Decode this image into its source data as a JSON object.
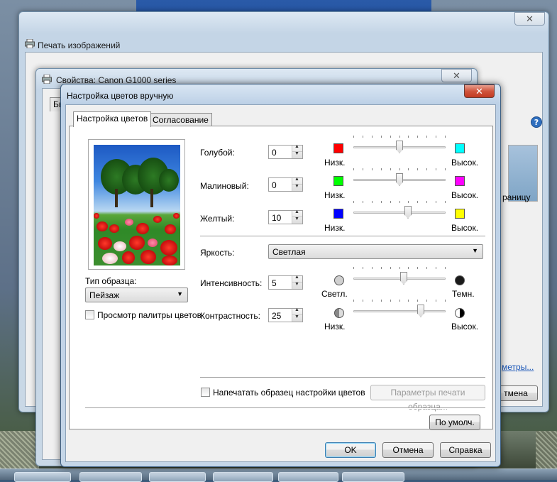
{
  "background_window": {
    "title": "Печать изображений",
    "partial_texts": {
      "rasteria": "раницу",
      "params_link": "метры...",
      "cancel_button": "тмена"
    }
  },
  "properties_window": {
    "title": "Свойства: Canon G1000 series",
    "partial_tab": "Бь",
    "close_glyph": "✕"
  },
  "dialog": {
    "title": "Настройка цветов вручную",
    "close_glyph": "✕",
    "tabs": [
      {
        "label": "Настройка цветов",
        "active": true
      },
      {
        "label": "Согласование",
        "active": false
      }
    ],
    "sample_type": {
      "label": "Тип образца:",
      "value": "Пейзаж"
    },
    "palette_preview": {
      "label": "Просмотр палитры цветов",
      "checked": false
    },
    "colors": [
      {
        "label": "Голубой:",
        "value": "0",
        "low_label": "Низк.",
        "high_label": "Высок.",
        "low_color": "#ff0000",
        "high_color": "#00ffff",
        "slider_level": 0.5
      },
      {
        "label": "Малиновый:",
        "value": "0",
        "low_label": "Низк.",
        "high_label": "Высок.",
        "low_color": "#00ff00",
        "high_color": "#ff00ff",
        "slider_level": 0.5
      },
      {
        "label": "Желтый:",
        "value": "10",
        "low_label": "Низк.",
        "high_label": "Высок.",
        "low_color": "#0000ff",
        "high_color": "#ffff00",
        "slider_level": 0.6
      }
    ],
    "brightness": {
      "label": "Яркость:",
      "value": "Светлая"
    },
    "intensity": {
      "label": "Интенсивность:",
      "value": "5",
      "low_label": "Светл.",
      "high_label": "Темн.",
      "slider_level": 0.55
    },
    "contrast": {
      "label": "Контрастность:",
      "value": "25",
      "low_label": "Низк.",
      "high_label": "Высок.",
      "slider_level": 0.75
    },
    "print_sample": {
      "label": "Напечатать образец настройки цветов",
      "checked": false
    },
    "sample_params_button": "Параметры печати образца...",
    "defaults_button": "По умолч.",
    "ok_button": "OK",
    "cancel_button": "Отмена",
    "help_button": "Справка"
  }
}
